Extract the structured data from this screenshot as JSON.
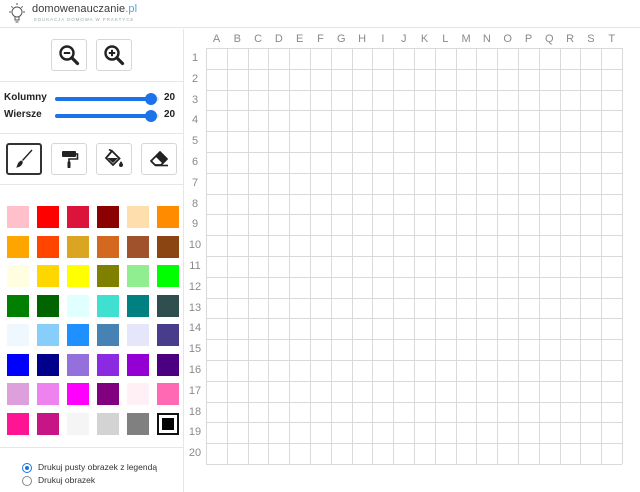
{
  "header": {
    "logo": {
      "brand_main": "domowenauczanie",
      "brand_tld": ".pl",
      "tagline": "EDUKACJA DOMOWA W PRAKTYCE",
      "icon": "lightbulb-icon"
    }
  },
  "sidebar": {
    "zoom": {
      "zoom_out_icon": "zoom-out-icon",
      "zoom_in_icon": "zoom-in-icon"
    },
    "sliders": {
      "columns": {
        "label": "Kolumny",
        "value": "20",
        "fraction": 0.92
      },
      "rows": {
        "label": "Wiersze",
        "value": "20",
        "fraction": 0.92
      },
      "accent": "#1a73e8"
    },
    "tools": [
      {
        "name": "brush",
        "icon": "paintbrush-icon",
        "active": true
      },
      {
        "name": "roller",
        "icon": "paint-roller-icon",
        "active": false
      },
      {
        "name": "fill",
        "icon": "paint-bucket-icon",
        "active": false
      },
      {
        "name": "eraser",
        "icon": "eraser-icon",
        "active": false
      }
    ],
    "palette": [
      [
        "#ffc0cb",
        "#ff0000",
        "#dc143c",
        "#8b0000",
        "#ffdead",
        "#ff8c00"
      ],
      [
        "#ffa500",
        "#ff4500",
        "#daa520",
        "#d2691e",
        "#a0522d",
        "#8b4513"
      ],
      [
        "#fffee0",
        "#ffd700",
        "#ffff00",
        "#808000",
        "#90ee90",
        "#00ff00"
      ],
      [
        "#008000",
        "#006400",
        "#e0ffff",
        "#40e0d0",
        "#008080",
        "#2f4f4f"
      ],
      [
        "#f0f8ff",
        "#87cefa",
        "#1e90ff",
        "#4682b4",
        "#e6e6fa",
        "#483d8b"
      ],
      [
        "#0000ff",
        "#00008b",
        "#9370db",
        "#8a2be2",
        "#9400d3",
        "#4b0082"
      ],
      [
        "#dda0dd",
        "#ee82ee",
        "#ff00ff",
        "#800080",
        "#fff0f5",
        "#ff69b4"
      ],
      [
        "#ff1493",
        "#c71585",
        "#f5f5f5",
        "#d3d3d3",
        "#808080",
        "#000000"
      ]
    ],
    "selected_color": "#000000",
    "print_options": [
      {
        "label": "Drukuj pusty obrazek z legendą",
        "checked": true
      },
      {
        "label": "Drukuj obrazek",
        "checked": false
      }
    ]
  },
  "board": {
    "columns": [
      "A",
      "B",
      "C",
      "D",
      "E",
      "F",
      "G",
      "H",
      "I",
      "J",
      "K",
      "L",
      "M",
      "N",
      "O",
      "P",
      "Q",
      "R",
      "S",
      "T"
    ],
    "rows": [
      "1",
      "2",
      "3",
      "4",
      "5",
      "6",
      "7",
      "8",
      "9",
      "10",
      "11",
      "12",
      "13",
      "14",
      "15",
      "16",
      "17",
      "18",
      "19",
      "20"
    ],
    "grid_color": "#d9d9d9"
  }
}
